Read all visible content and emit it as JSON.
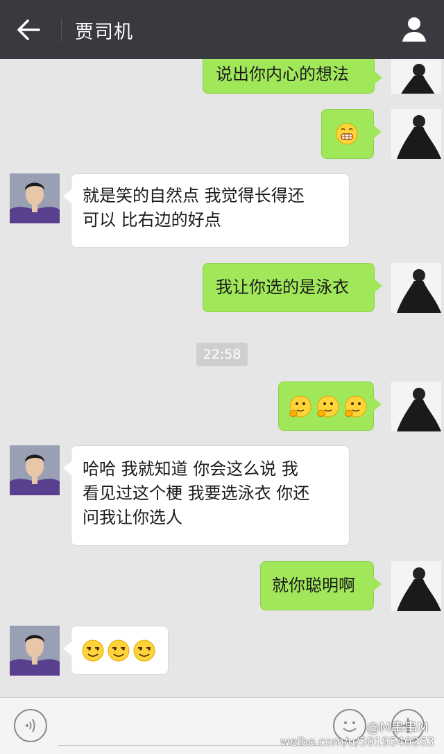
{
  "header": {
    "title": "贾司机"
  },
  "messages": [
    {
      "sender": "me",
      "text": "说出你内心的想法"
    },
    {
      "sender": "me",
      "emoji": [
        "grin-emoji"
      ]
    },
    {
      "sender": "other",
      "text": "就是笑的自然点 我觉得长得还\n可以 比右边的好点"
    },
    {
      "sender": "me",
      "text": "我让你选的是泳衣"
    },
    {
      "timestamp": "22:58"
    },
    {
      "sender": "me",
      "emoji": [
        "shy-emoji",
        "shy-emoji",
        "shy-emoji"
      ]
    },
    {
      "sender": "other",
      "text": "哈哈 我就知道 你会这么说 我\n看见过这个梗 我要选泳衣 你还\n问我让你选人"
    },
    {
      "sender": "me",
      "text": "就你聪明啊"
    },
    {
      "sender": "other",
      "emoji": [
        "smirk-emoji",
        "smirk-emoji",
        "smirk-emoji"
      ]
    }
  ],
  "watermark": {
    "line1": "@M串串M",
    "line2": "weibo.com/u/5019540263"
  },
  "colors": {
    "topbar": "#393a3f",
    "sent_bubble": "#a0e75a",
    "received_bubble": "#ffffff",
    "chat_bg": "#e6e6e6"
  }
}
